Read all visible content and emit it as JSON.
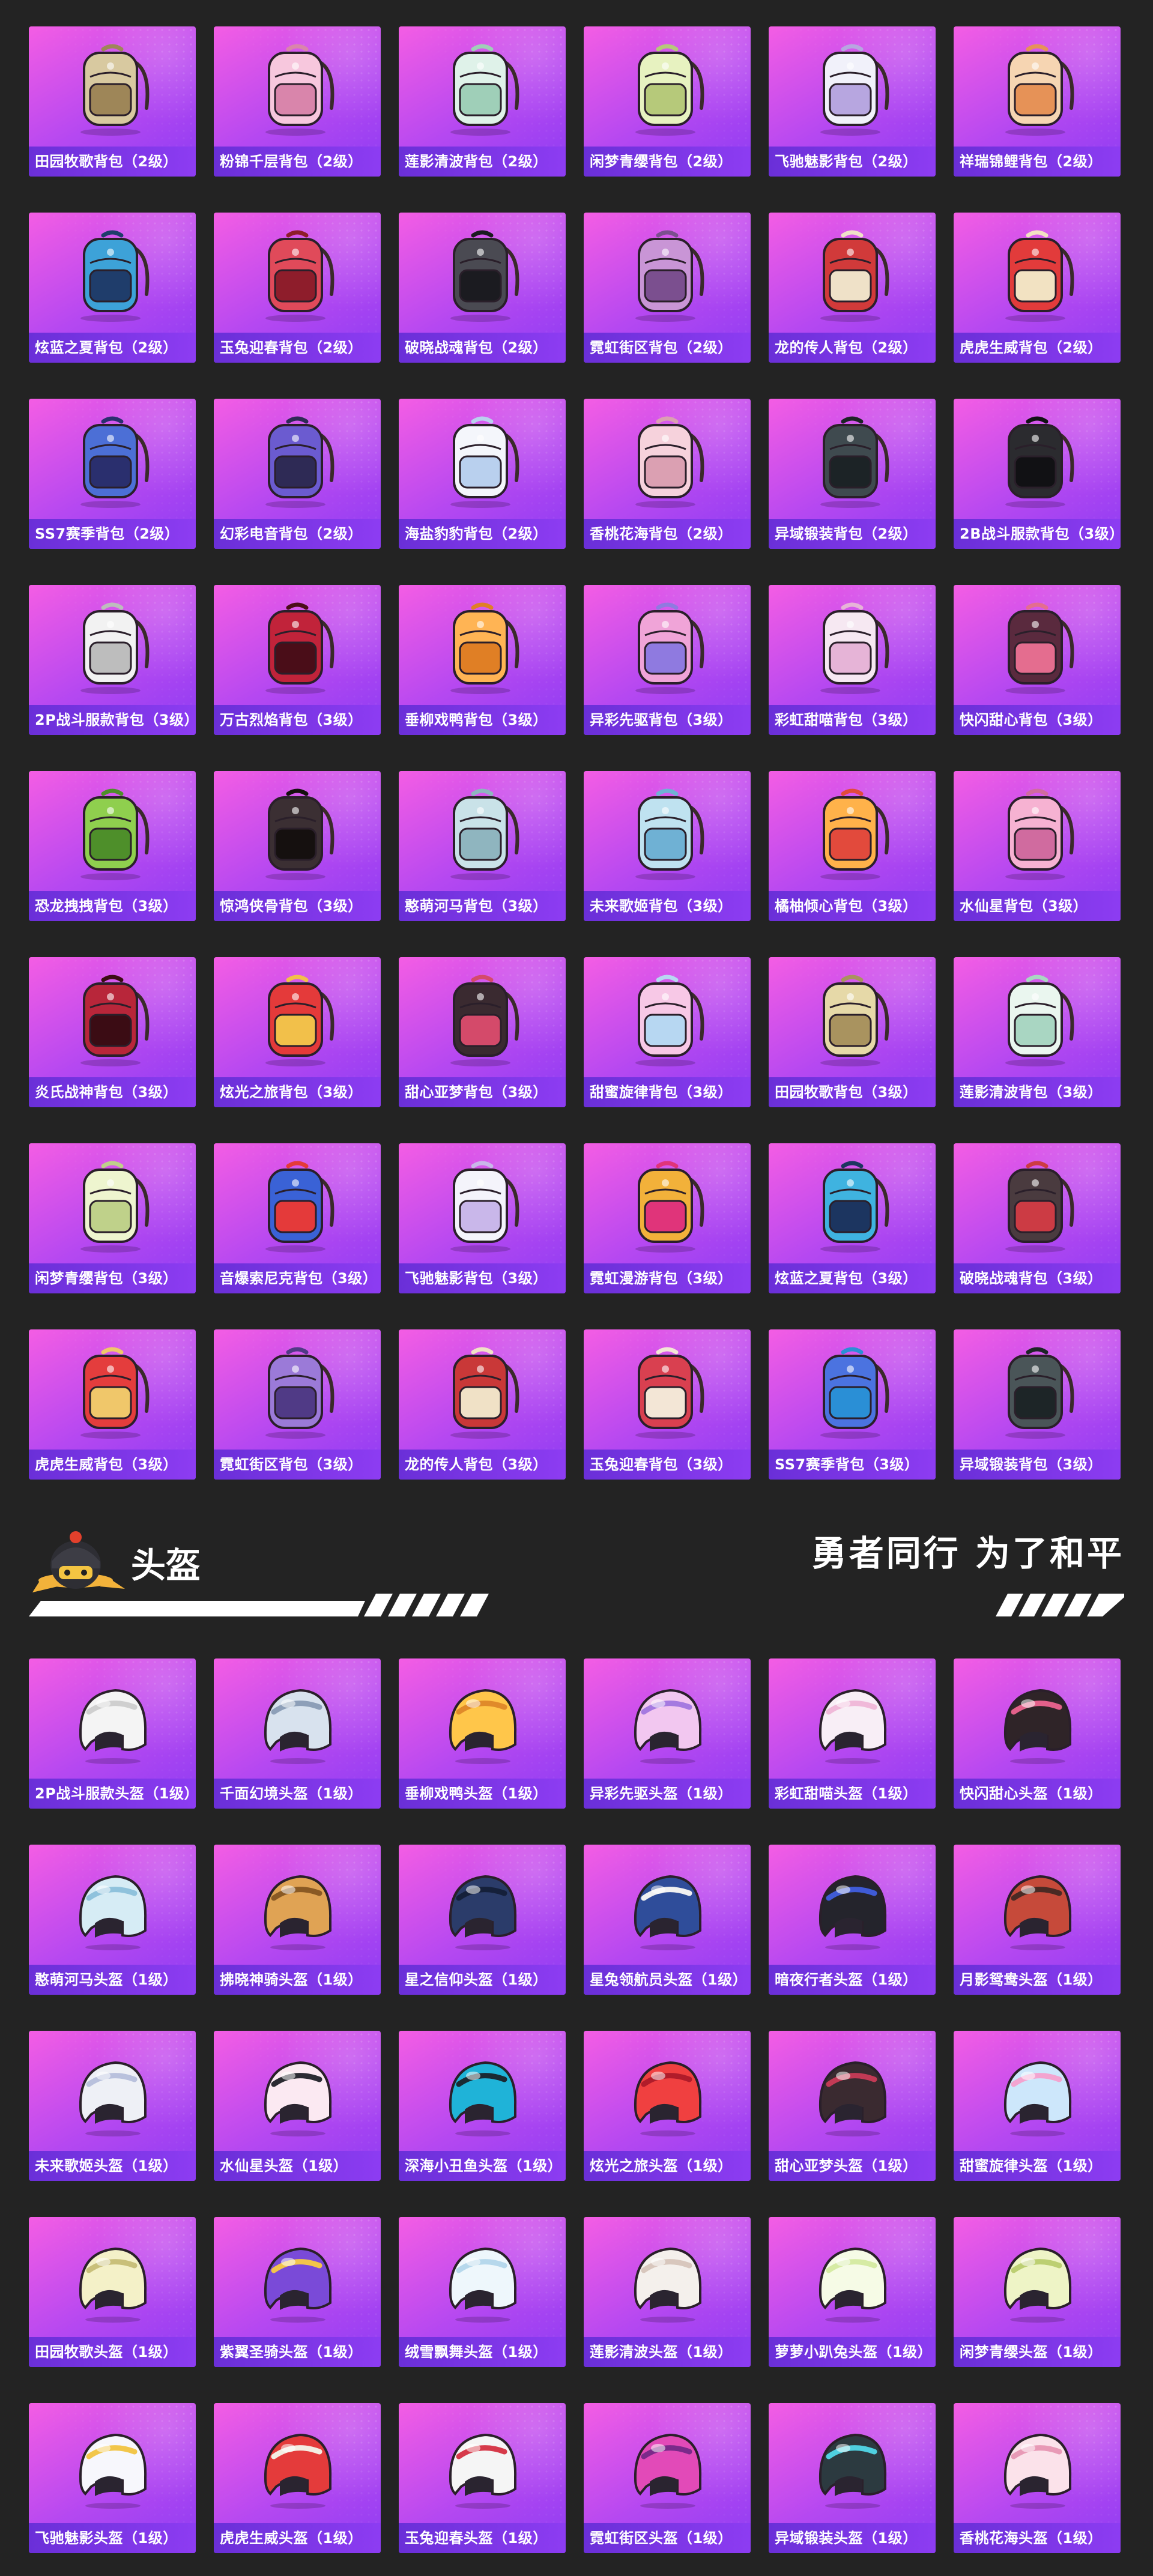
{
  "backpacks": [
    {
      "name": "田园牧歌背包（2级）",
      "icon": "wicker-backpack-icon",
      "c1": "#d8c9a0",
      "c2": "#9e8658"
    },
    {
      "name": "粉锦千层背包（2级）",
      "icon": "pink-backpack-icon",
      "c1": "#f7c7dd",
      "c2": "#d985ab"
    },
    {
      "name": "莲影清波背包（2级）",
      "icon": "lotus-backpack-icon",
      "c1": "#dff2e9",
      "c2": "#9fcfb8"
    },
    {
      "name": "闲梦青缨背包（2级）",
      "icon": "green-backpack-icon",
      "c1": "#e7f2c0",
      "c2": "#b6c97a"
    },
    {
      "name": "飞驰魅影背包（2级）",
      "icon": "white-backpack-icon",
      "c1": "#f1f1fa",
      "c2": "#b7a6e0"
    },
    {
      "name": "祥瑞锦鲤背包（2级）",
      "icon": "koi-backpack-icon",
      "c1": "#f6d5b2",
      "c2": "#e69257"
    },
    {
      "name": "炫蓝之夏背包（2级）",
      "icon": "blue-backpack-icon",
      "c1": "#3da2d8",
      "c2": "#1f3d6b"
    },
    {
      "name": "玉兔迎春背包（2级）",
      "icon": "red-backpack-icon",
      "c1": "#e04a5a",
      "c2": "#8e1d2b"
    },
    {
      "name": "破晓战魂背包（2级）",
      "icon": "black-backpack-icon",
      "c1": "#4a4a52",
      "c2": "#1b1b20"
    },
    {
      "name": "霓虹街区背包（2级）",
      "icon": "neon-backpack-icon",
      "c1": "#c995d6",
      "c2": "#7b4f8f"
    },
    {
      "name": "龙的传人背包（2级）",
      "icon": "dragon-backpack-icon",
      "c1": "#d13a3a",
      "c2": "#efe1c8"
    },
    {
      "name": "虎虎生威背包（2级）",
      "icon": "tiger-backpack-icon",
      "c1": "#e23b3b",
      "c2": "#f2e2c2"
    },
    {
      "name": "SS7赛季背包（2级）",
      "icon": "ss7-backpack-icon",
      "c1": "#4c6fd6",
      "c2": "#2a2f6e"
    },
    {
      "name": "幻彩电音背包（2级）",
      "icon": "electro-backpack-icon",
      "c1": "#6b5bd0",
      "c2": "#2e2a55"
    },
    {
      "name": "海盐豹豹背包（2级）",
      "icon": "leopard-backpack-icon",
      "c1": "#f4f6fb",
      "c2": "#b9d0ee"
    },
    {
      "name": "香桃花海背包（2级）",
      "icon": "peach-backpack-icon",
      "c1": "#f6d2dc",
      "c2": "#dba0b2"
    },
    {
      "name": "异域锻装背包（2级）",
      "icon": "exotic-backpack-icon",
      "c1": "#3f4a4f",
      "c2": "#1c2326"
    },
    {
      "name": "2B战斗服款背包（3级）",
      "icon": "2b-backpack-icon",
      "c1": "#2b2b2f",
      "c2": "#111114"
    },
    {
      "name": "2P战斗服款背包（3级）",
      "icon": "2p-backpack-icon",
      "c1": "#f2f2f2",
      "c2": "#bdbdbd"
    },
    {
      "name": "万古烈焰背包（3级）",
      "icon": "flame-backpack-icon",
      "c1": "#c1233a",
      "c2": "#4a0d18"
    },
    {
      "name": "垂柳戏鸭背包（3级）",
      "icon": "duck-backpack-icon",
      "c1": "#ffb454",
      "c2": "#e07f25"
    },
    {
      "name": "异彩先驱背包（3级）",
      "icon": "pioneer-backpack-icon",
      "c1": "#f0a4d8",
      "c2": "#8f7ae0"
    },
    {
      "name": "彩虹甜喵背包（3级）",
      "icon": "cat-backpack-icon",
      "c1": "#f6e8f2",
      "c2": "#e6b4d7"
    },
    {
      "name": "快闪甜心背包（3级）",
      "icon": "sweetheart-backpack-icon",
      "c1": "#5a2a3e",
      "c2": "#e46d8f"
    },
    {
      "name": "恐龙拽拽背包（3级）",
      "icon": "dino-backpack-icon",
      "c1": "#8fcf4e",
      "c2": "#4e8f2a"
    },
    {
      "name": "惊鸿侠骨背包（3级）",
      "icon": "knight-backpack-icon",
      "c1": "#3b2f33",
      "c2": "#15100f"
    },
    {
      "name": "憨萌河马背包（3级）",
      "icon": "hippo-backpack-icon",
      "c1": "#c9e2e8",
      "c2": "#8fb5bf"
    },
    {
      "name": "未来歌姬背包（3级）",
      "icon": "diva-backpack-icon",
      "c1": "#bfe2f0",
      "c2": "#6fb1d4"
    },
    {
      "name": "橘柚倾心背包（3级）",
      "icon": "orange-backpack-icon",
      "c1": "#ffb24a",
      "c2": "#e24a3c"
    },
    {
      "name": "水仙星背包（3级）",
      "icon": "narcissus-backpack-icon",
      "c1": "#f6b2d2",
      "c2": "#d06b9f"
    },
    {
      "name": "炎氏战神背包（3级）",
      "icon": "war-god-backpack-icon",
      "c1": "#b8263a",
      "c2": "#3b0c14"
    },
    {
      "name": "炫光之旅背包（3级）",
      "icon": "journey-backpack-icon",
      "c1": "#e43a3a",
      "c2": "#f2c04a"
    },
    {
      "name": "甜心亚梦背包（3级）",
      "icon": "amu-backpack-icon",
      "c1": "#3a2a30",
      "c2": "#d44a6a"
    },
    {
      "name": "甜蜜旋律背包（3级）",
      "icon": "melody-backpack-icon",
      "c1": "#f7c8e6",
      "c2": "#b7d7f2"
    },
    {
      "name": "田园牧歌背包（3级）",
      "icon": "wicker-backpack-icon",
      "c1": "#e6d9a8",
      "c2": "#a9935f"
    },
    {
      "name": "莲影清波背包（3级）",
      "icon": "lotus-backpack-icon",
      "c1": "#eaf6ef",
      "c2": "#a9d6c2"
    },
    {
      "name": "闲梦青缨背包（3级）",
      "icon": "green-backpack-icon",
      "c1": "#eef5cf",
      "c2": "#bfd18a"
    },
    {
      "name": "音爆索尼克背包（3级）",
      "icon": "sonic-backpack-icon",
      "c1": "#3a62d6",
      "c2": "#e43a3a"
    },
    {
      "name": "飞驰魅影背包（3级）",
      "icon": "white-backpack-icon",
      "c1": "#f4f4fb",
      "c2": "#c9b7ea"
    },
    {
      "name": "霓虹漫游背包（3级）",
      "icon": "neon-roam-backpack-icon",
      "c1": "#f2b13a",
      "c2": "#e0347a"
    },
    {
      "name": "炫蓝之夏背包（3级）",
      "icon": "blue-backpack-icon",
      "c1": "#3fb3e0",
      "c2": "#1c3560"
    },
    {
      "name": "破晓战魂背包（3级）",
      "icon": "black-backpack-icon",
      "c1": "#4a3b3f",
      "c2": "#cc3b44"
    },
    {
      "name": "虎虎生威背包（3级）",
      "icon": "tiger-backpack-icon",
      "c1": "#e43d3d",
      "c2": "#f0c76a"
    },
    {
      "name": "霓虹街区背包（3级）",
      "icon": "neon-backpack-icon",
      "c1": "#9b7ad8",
      "c2": "#503a86"
    },
    {
      "name": "龙的传人背包（3级）",
      "icon": "dragon-backpack-icon",
      "c1": "#c93838",
      "c2": "#f0e1c6"
    },
    {
      "name": "玉兔迎春背包（3级）",
      "icon": "red-backpack-icon",
      "c1": "#d94050",
      "c2": "#f3e6d6"
    },
    {
      "name": "SS7赛季背包（3级）",
      "icon": "ss7-backpack-icon",
      "c1": "#4b73e0",
      "c2": "#2a8fd6"
    },
    {
      "name": "异域锻装背包（3级）",
      "icon": "exotic-backpack-icon",
      "c1": "#4a5558",
      "c2": "#1d2527"
    }
  ],
  "section": {
    "title": "头盔",
    "slogan": "勇者同行 为了和平",
    "mascot_icon": "helmet-mascot-icon"
  },
  "helmets": [
    {
      "name": "2P战斗服款头盔（1级）",
      "icon": "helmet-icon",
      "c1": "#f4f4f4",
      "c2": "#cfcfcf"
    },
    {
      "name": "千面幻境头盔（1级）",
      "icon": "helmet-icon",
      "c1": "#d8e2ee",
      "c2": "#8d9fb8"
    },
    {
      "name": "垂柳戏鸭头盔（1级）",
      "icon": "helmet-icon",
      "c1": "#ffc64a",
      "c2": "#e08a2a"
    },
    {
      "name": "异彩先驱头盔（1级）",
      "icon": "helmet-icon",
      "c1": "#f2c7f0",
      "c2": "#a57ae0"
    },
    {
      "name": "彩虹甜喵头盔（1级）",
      "icon": "helmet-icon",
      "c1": "#f8eef6",
      "c2": "#f0b9d9"
    },
    {
      "name": "快闪甜心头盔（1级）",
      "icon": "helmet-icon",
      "c1": "#2f2428",
      "c2": "#e2608a"
    },
    {
      "name": "憨萌河马头盔（1级）",
      "icon": "helmet-icon",
      "c1": "#d6ecf5",
      "c2": "#8fc2dc"
    },
    {
      "name": "拂晓神骑头盔（1级）",
      "icon": "helmet-icon",
      "c1": "#e0a354",
      "c2": "#8a5a24"
    },
    {
      "name": "星之信仰头盔（1级）",
      "icon": "helmet-icon",
      "c1": "#2b3c6a",
      "c2": "#15203a"
    },
    {
      "name": "星兔领航员头盔（1级）",
      "icon": "helmet-icon",
      "c1": "#2f4d9a",
      "c2": "#f0f0f0"
    },
    {
      "name": "暗夜行者头盔（1级）",
      "icon": "helmet-icon",
      "c1": "#24242c",
      "c2": "#3f5bd6"
    },
    {
      "name": "月影鸳鸯头盔（1级）",
      "icon": "helmet-icon",
      "c1": "#c64a3a",
      "c2": "#4a2a24"
    },
    {
      "name": "未来歌姬头盔（1级）",
      "icon": "helmet-icon",
      "c1": "#eef0f6",
      "c2": "#b9c1dd"
    },
    {
      "name": "水仙星头盔（1级）",
      "icon": "helmet-icon",
      "c1": "#fbe9f2",
      "c2": "#2b2b33"
    },
    {
      "name": "深海小丑鱼头盔（1级）",
      "icon": "helmet-icon",
      "c1": "#1fb3d8",
      "c2": "#1a2a33"
    },
    {
      "name": "炫光之旅头盔（1级）",
      "icon": "helmet-icon",
      "c1": "#f04040",
      "c2": "#b01c2a"
    },
    {
      "name": "甜心亚梦头盔（1级）",
      "icon": "helmet-icon",
      "c1": "#3a2a30",
      "c2": "#c23a55"
    },
    {
      "name": "甜蜜旋律头盔（1级）",
      "icon": "helmet-icon",
      "c1": "#cde7fb",
      "c2": "#f3a4d0"
    },
    {
      "name": "田园牧歌头盔（1级）",
      "icon": "helmet-icon",
      "c1": "#f4f1c8",
      "c2": "#c9c07a"
    },
    {
      "name": "紫翼圣骑头盔（1级）",
      "icon": "helmet-icon",
      "c1": "#7a4ad8",
      "c2": "#f2c54a"
    },
    {
      "name": "绒雪飘舞头盔（1级）",
      "icon": "helmet-icon",
      "c1": "#eef7fc",
      "c2": "#b6d8ec"
    },
    {
      "name": "莲影清波头盔（1级）",
      "icon": "helmet-icon",
      "c1": "#f4f0ec",
      "c2": "#d8c7bd"
    },
    {
      "name": "萝萝小趴兔头盔（1级）",
      "icon": "helmet-icon",
      "c1": "#f6fbe6",
      "c2": "#d6eba4"
    },
    {
      "name": "闲梦青缨头盔（1级）",
      "icon": "helmet-icon",
      "c1": "#eef4c6",
      "c2": "#bccf72"
    },
    {
      "name": "飞驰魅影头盔（1级）",
      "icon": "helmet-icon",
      "c1": "#f7f7fc",
      "c2": "#f2c64a"
    },
    {
      "name": "虎虎生威头盔（1级）",
      "icon": "helmet-icon",
      "c1": "#e43b3b",
      "c2": "#f3ede2"
    },
    {
      "name": "玉兔迎春头盔（1级）",
      "icon": "helmet-icon",
      "c1": "#f5f5f5",
      "c2": "#d63a4a"
    },
    {
      "name": "霓虹街区头盔（1级）",
      "icon": "helmet-icon",
      "c1": "#e24ab8",
      "c2": "#7a2a8a"
    },
    {
      "name": "异域锻装头盔（1级）",
      "icon": "helmet-icon",
      "c1": "#2c3a40",
      "c2": "#4fd0e0"
    },
    {
      "name": "香桃花海头盔（1级）",
      "icon": "helmet-icon",
      "c1": "#fbe2ea",
      "c2": "#e89ab6"
    }
  ]
}
